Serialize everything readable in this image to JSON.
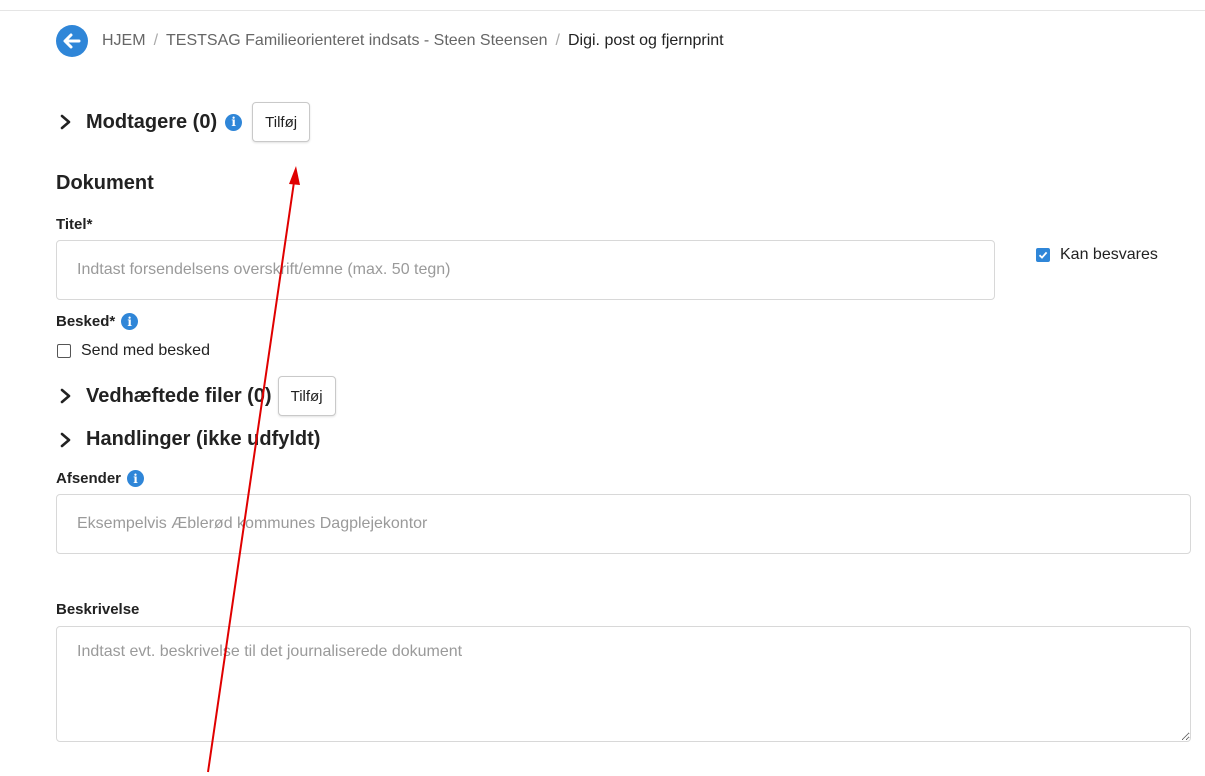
{
  "breadcrumb": {
    "home": "HJEM",
    "separator": "/",
    "case": "TESTSAG Familieorienteret indsats - Steen Steensen",
    "current": "Digi. post og fjernprint"
  },
  "recipients": {
    "title": "Modtagere (0)",
    "add_label": "Tilføj"
  },
  "document": {
    "heading": "Dokument",
    "title_label": "Titel*",
    "title_placeholder": "Indtast forsendelsens overskrift/emne (max. 50 tegn)",
    "can_reply_label": "Kan besvares",
    "can_reply_checked": true,
    "message_label": "Besked*",
    "send_with_message_label": "Send med besked",
    "send_with_message_checked": false
  },
  "attachments": {
    "title": "Vedhæftede filer (0)",
    "add_label": "Tilføj"
  },
  "actions": {
    "title": "Handlinger (ikke udfyldt)"
  },
  "sender": {
    "label": "Afsender",
    "placeholder": "Eksempelvis Æblerød kommunes Dagplejekontor"
  },
  "description": {
    "label": "Beskrivelse",
    "placeholder": "Indtast evt. beskrivelse til det journaliserede dokument"
  },
  "colors": {
    "accent": "#2f86d8",
    "annotation_arrow": "#e00000"
  },
  "icons": [
    "back-arrow-icon",
    "chevron-right-icon",
    "info-icon",
    "checkmark-icon"
  ]
}
